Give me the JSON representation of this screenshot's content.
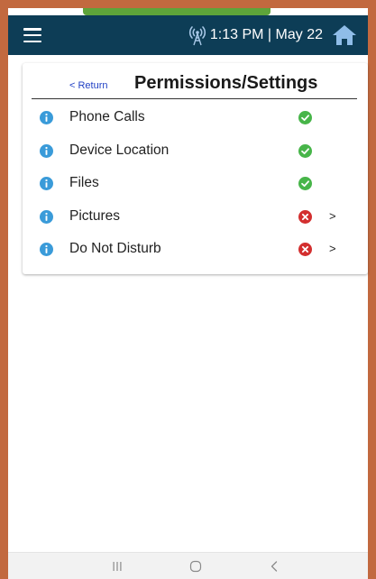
{
  "appbar": {
    "time_date": "1:13 PM | May 22",
    "menu_icon": "hamburger-menu-icon",
    "signal_icon": "broadcast-signal-icon",
    "home_icon": "home-icon",
    "background_color": "#0d3d56",
    "accent_color": "#5ea43a"
  },
  "card": {
    "return_label": "< Return",
    "title": "Permissions/Settings",
    "items": [
      {
        "label": "Phone Calls",
        "status": "granted",
        "has_chevron": false
      },
      {
        "label": "Device Location",
        "status": "granted",
        "has_chevron": false
      },
      {
        "label": "Files",
        "status": "granted",
        "has_chevron": false
      },
      {
        "label": "Pictures",
        "status": "denied",
        "has_chevron": true,
        "chevron": ">"
      },
      {
        "label": "Do Not Disturb",
        "status": "denied",
        "has_chevron": true,
        "chevron": ">"
      }
    ]
  },
  "colors": {
    "frame": "#c2693f",
    "info": "#3a9bd9",
    "granted": "#47b549",
    "denied": "#d32f2f",
    "link": "#1f3fc4"
  },
  "navbar": {
    "recent_icon": "recent-apps-icon",
    "home_icon": "home-circle-icon",
    "back_icon": "back-chevron-icon"
  }
}
